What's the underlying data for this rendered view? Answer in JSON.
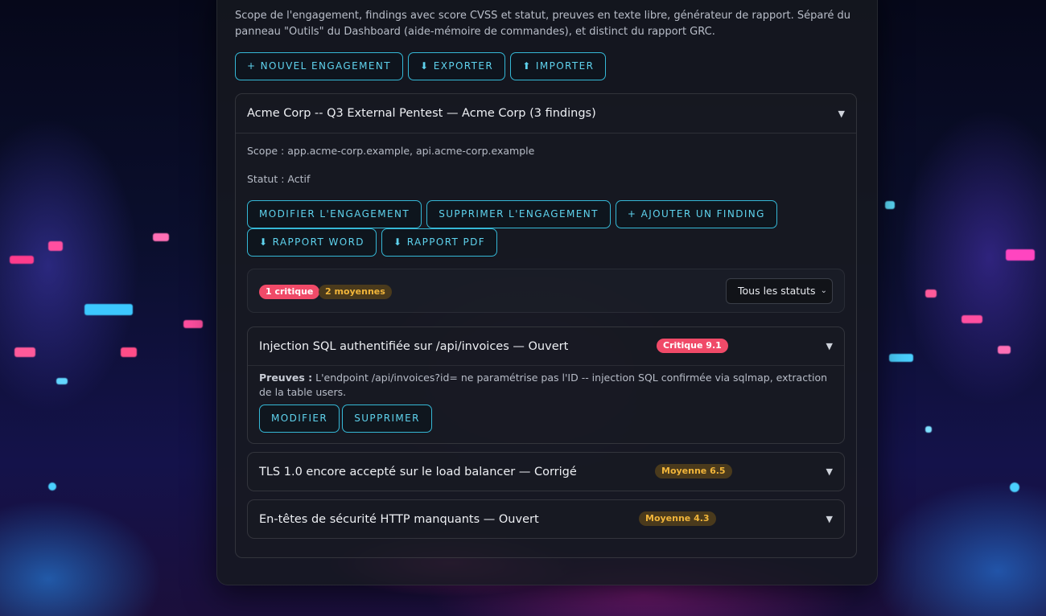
{
  "description": "Scope de l'engagement, findings avec score CVSS et statut, preuves en texte libre, générateur de rapport. Séparé du panneau \"Outils\" du Dashboard (aide-mémoire de commandes), et distinct du rapport GRC.",
  "top_actions": {
    "new": "+ NOUVEL ENGAGEMENT",
    "export": "⬇ EXPORTER",
    "import": "⬆ IMPORTER"
  },
  "engagement": {
    "title": "Acme Corp -- Q3 External Pentest — Acme Corp (3 findings)",
    "scope": "Scope : app.acme-corp.example, api.acme-corp.example",
    "status": "Statut : Actif",
    "actions": {
      "edit": "MODIFIER L'ENGAGEMENT",
      "delete": "SUPPRIMER L'ENGAGEMENT",
      "add_finding": "+ AJOUTER UN FINDING",
      "word_report": "⬇ RAPPORT WORD",
      "pdf_report": "⬇ RAPPORT PDF"
    },
    "summary": {
      "critical": "1 critique",
      "medium": "2 moyennes",
      "status_filter": "Tous les statuts"
    },
    "findings": [
      {
        "title": "Injection SQL authentifiée sur /api/invoices — Ouvert",
        "badge": "Critique 9.1",
        "proof_label": "Preuves :",
        "proof": "L'endpoint /api/invoices?id= ne paramétrise pas l'ID -- injection SQL confirmée via sqlmap, extraction de la table users.",
        "edit": "MODIFIER",
        "delete": "SUPPRIMER"
      },
      {
        "title": "TLS 1.0 encore accepté sur le load balancer — Corrigé",
        "badge": "Moyenne 6.5"
      },
      {
        "title": "En-têtes de sécurité HTTP manquants — Ouvert",
        "badge": "Moyenne 4.3"
      }
    ]
  },
  "colors": {
    "accent": "#35b8d6",
    "critical": "#f04a68",
    "medium": "#f1b53a"
  }
}
